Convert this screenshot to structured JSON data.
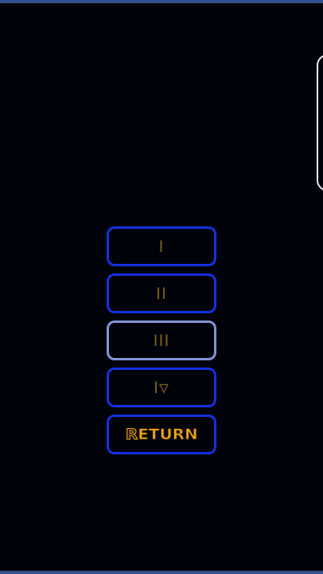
{
  "menu": {
    "buttons": [
      {
        "label": "Ⅰ",
        "selected": false
      },
      {
        "label": "ⅠⅠ",
        "selected": false
      },
      {
        "label": "ⅠⅠⅠ",
        "selected": true
      },
      {
        "label": "Ⅰ▽",
        "selected": false
      }
    ],
    "return": {
      "first_letter": "R",
      "rest": "ETURN"
    }
  },
  "colors": {
    "background": "#000309",
    "button_border": "#1530e0",
    "selected_border": "#8592d8",
    "label": "#7a5e1c",
    "return_text": "#f3a61a",
    "frame": "#34508f",
    "side_panel_border": "#e9ecf6"
  }
}
